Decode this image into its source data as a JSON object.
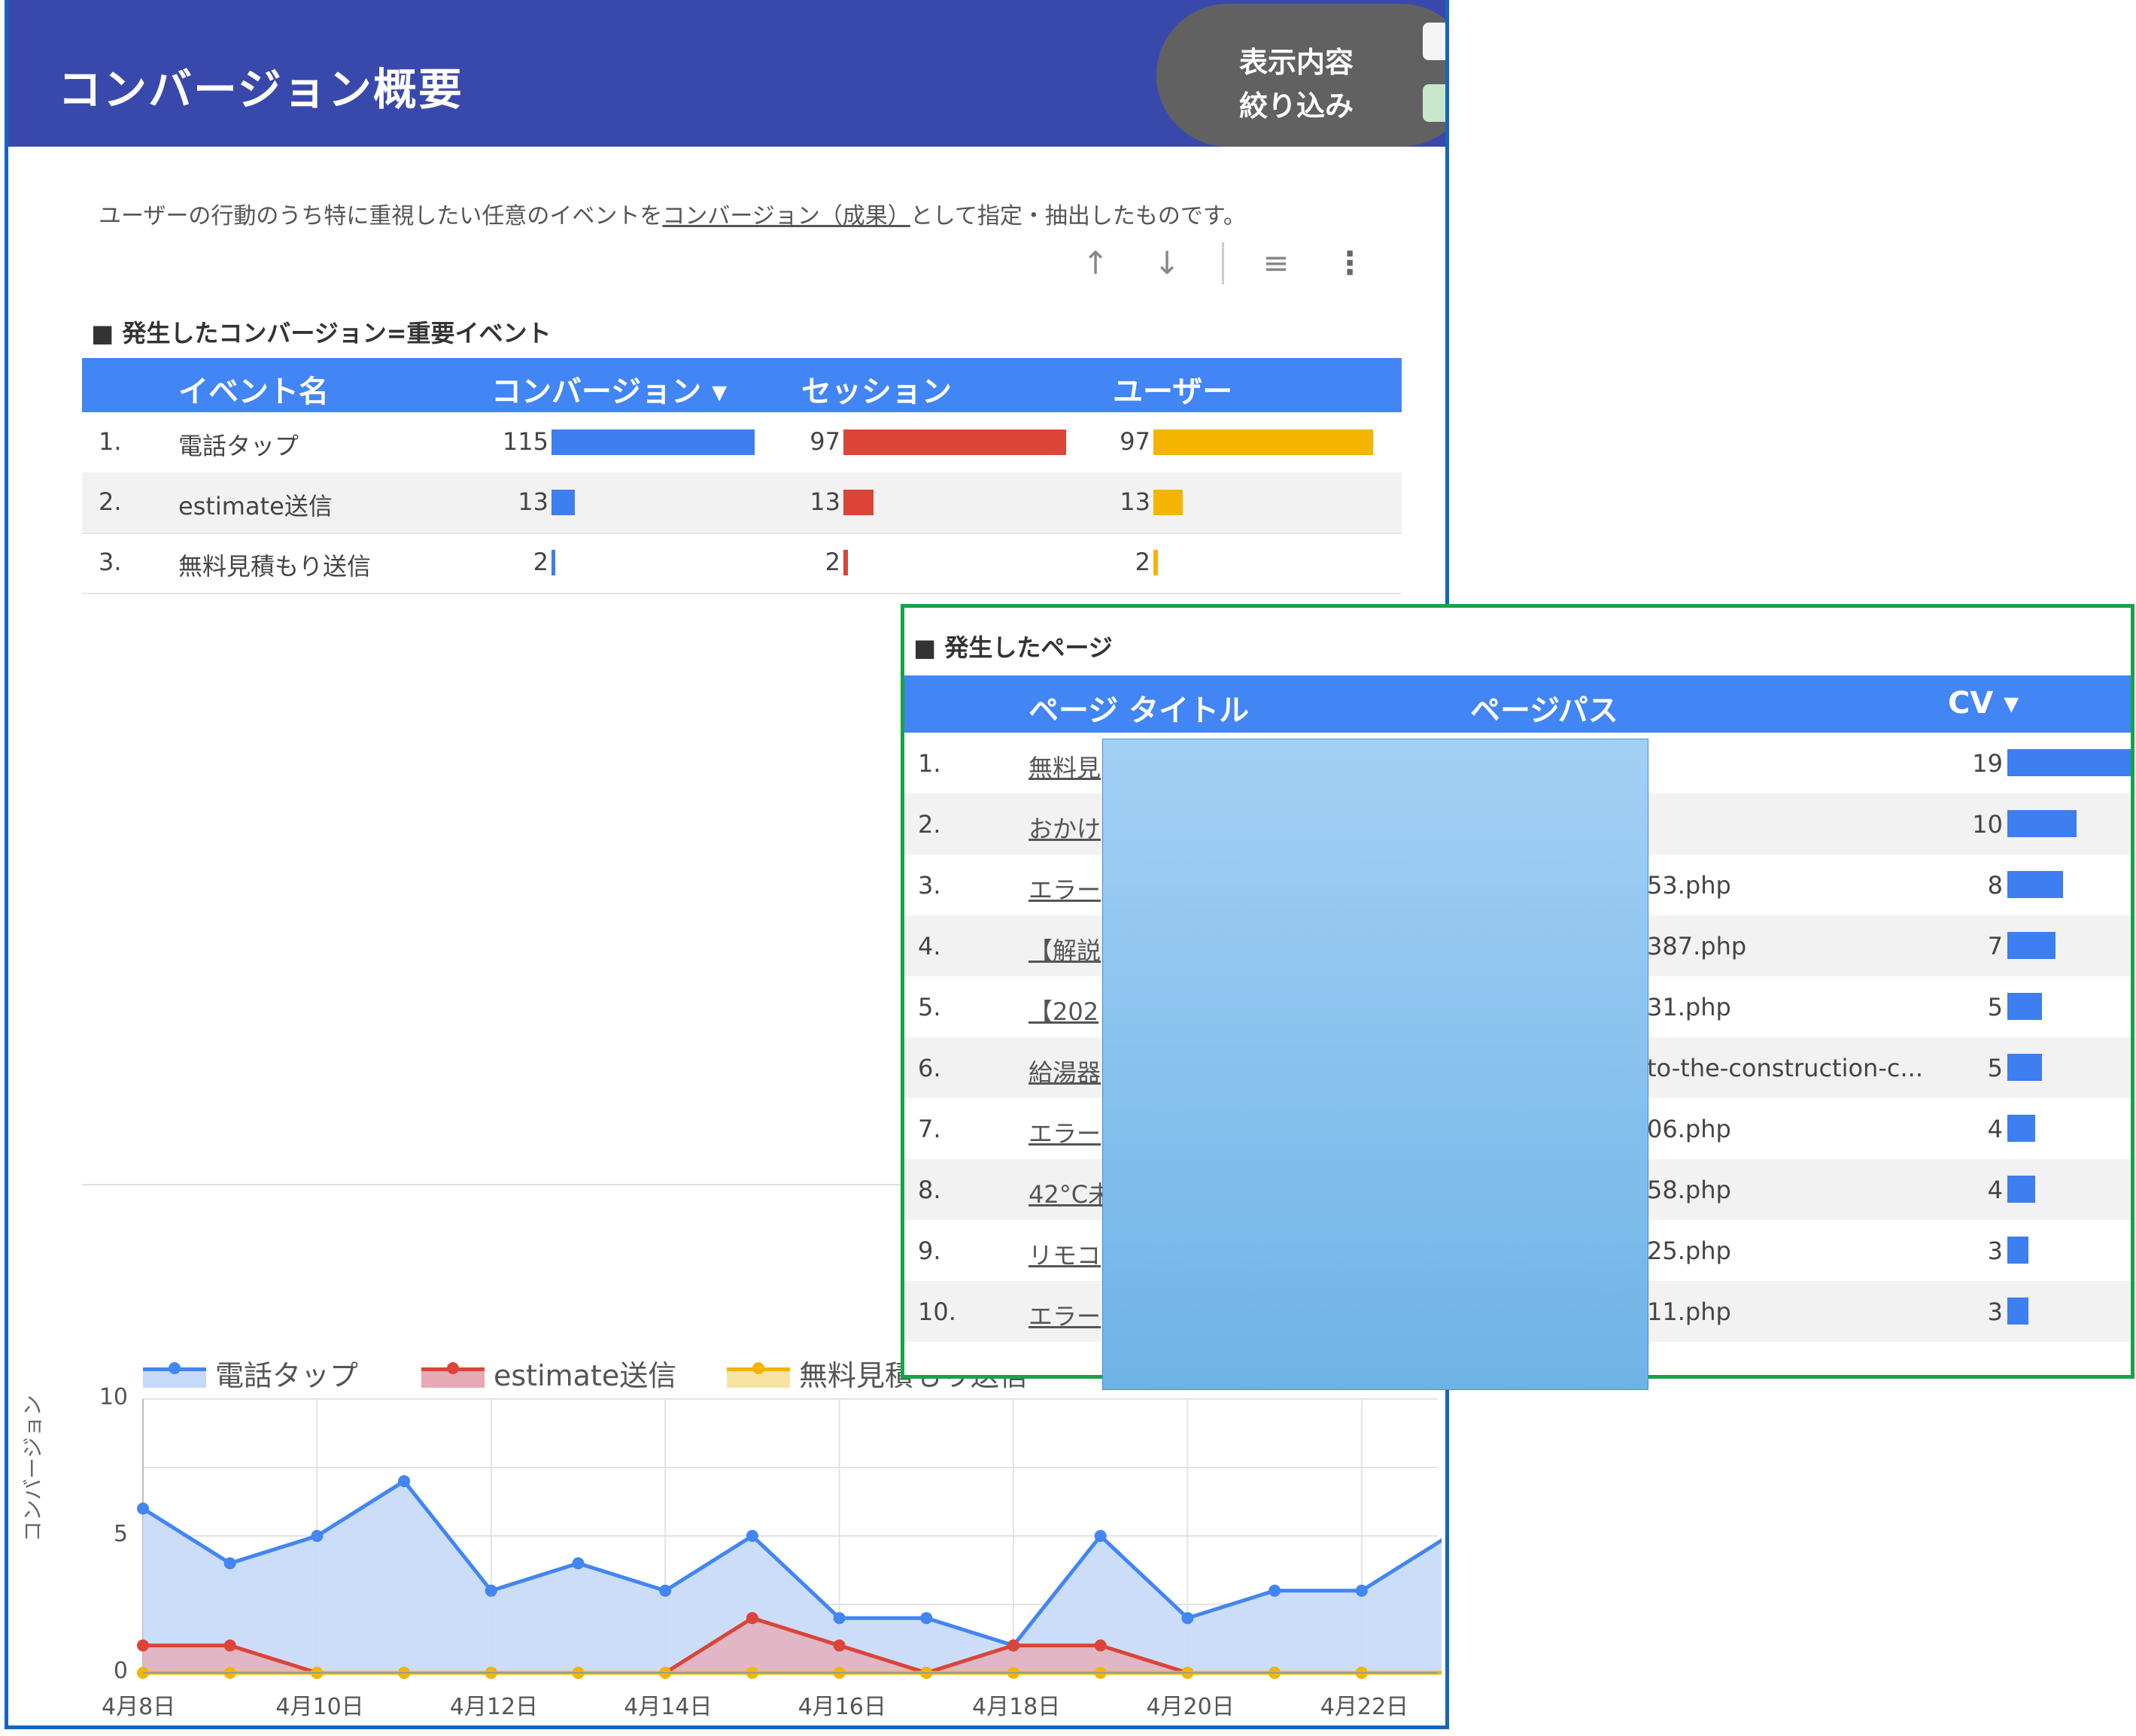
{
  "header": {
    "title": "コンバージョン概要",
    "filter_labels": [
      "表示内容",
      "絞り込み"
    ]
  },
  "description": {
    "before": "ユーザーの行動のうち特に重視したい任意のイベントを",
    "link": "コンバージョン（成果）",
    "after": "として指定・抽出したものです。"
  },
  "toolbar": {
    "sort_up": "↑",
    "sort_down": "↓",
    "filter": "≡",
    "more": "⋮"
  },
  "events_table": {
    "title": "■ 発生したコンバージョン=重要イベント",
    "columns": [
      "イベント名",
      "コンバージョン ▾",
      "セッション",
      "ユーザー"
    ],
    "rows": [
      {
        "rank": "1.",
        "name": "電話タップ",
        "conversions": 115,
        "sessions": 97,
        "users": 97
      },
      {
        "rank": "2.",
        "name": "estimate送信",
        "conversions": 13,
        "sessions": 13,
        "users": 13
      },
      {
        "rank": "3.",
        "name": "無料見積もり送信",
        "conversions": 2,
        "sessions": 2,
        "users": 2
      }
    ],
    "colors": {
      "conversions": "#3d7ef0",
      "sessions": "#db4437",
      "users": "#f4b400"
    }
  },
  "pages_table": {
    "title": "■ 発生したページ",
    "columns": [
      "ページ タイトル",
      "ページパス",
      "CV ▾"
    ],
    "rows": [
      {
        "rank": "1.",
        "title": "無料見",
        "path": "",
        "cv": 19
      },
      {
        "rank": "2.",
        "title": "おかけ",
        "path": "",
        "cv": 10
      },
      {
        "rank": "3.",
        "title": "エラー",
        "path": "53.php",
        "cv": 8
      },
      {
        "rank": "4.",
        "title": "【解説",
        "path": "387.php",
        "cv": 7
      },
      {
        "rank": "5.",
        "title": "【202",
        "path": "31.php",
        "cv": 5
      },
      {
        "rank": "6.",
        "title": "給湯器",
        "path": "to-the-construction-c...",
        "cv": 5
      },
      {
        "rank": "7.",
        "title": "エラー",
        "path": "06.php",
        "cv": 4
      },
      {
        "rank": "8.",
        "title": "42°C未",
        "path": "58.php",
        "cv": 4
      },
      {
        "rank": "9.",
        "title": "リモコ",
        "path": "25.php",
        "cv": 3
      },
      {
        "rank": "10.",
        "title": "エラー",
        "path": "11.php",
        "cv": 3
      }
    ],
    "bar_color": "#3d7ef0"
  },
  "chart_data": {
    "type": "area",
    "ylabel": "コンバージョン",
    "ylim": [
      0,
      10
    ],
    "yticks": [
      "0",
      "5",
      "10"
    ],
    "x": [
      "4月8日",
      "4月9日",
      "4月10日",
      "4月11日",
      "4月12日",
      "4月13日",
      "4月14日",
      "4月15日",
      "4月16日",
      "4月17日",
      "4月18日",
      "4月19日",
      "4月20日",
      "4月21日",
      "4月22日",
      "4月23日"
    ],
    "xtick_labels": [
      "4月8日",
      "4月10日",
      "4月12日",
      "4月14日",
      "4月16日",
      "4月18日",
      "4月20日",
      "4月22日"
    ],
    "series": [
      {
        "name": "電話タップ",
        "color": "#4285f4",
        "fill": "#c7d9f8",
        "values": [
          6,
          4,
          5,
          7,
          3,
          4,
          3,
          5,
          2,
          2,
          1,
          5,
          2,
          3,
          3,
          5
        ]
      },
      {
        "name": "estimate送信",
        "color": "#db4437",
        "fill": "#e8a9b4",
        "values": [
          1,
          1,
          0,
          0,
          0,
          0,
          0,
          2,
          1,
          0,
          1,
          1,
          0,
          0,
          0,
          0
        ]
      },
      {
        "name": "無料見積もり送信",
        "color": "#f4b400",
        "fill": "#f9e3a0",
        "values": [
          0,
          0,
          0,
          0,
          0,
          0,
          0,
          0,
          0,
          0,
          0,
          0,
          0,
          0,
          0,
          0
        ]
      }
    ],
    "grid": true,
    "legend": "top-left"
  }
}
